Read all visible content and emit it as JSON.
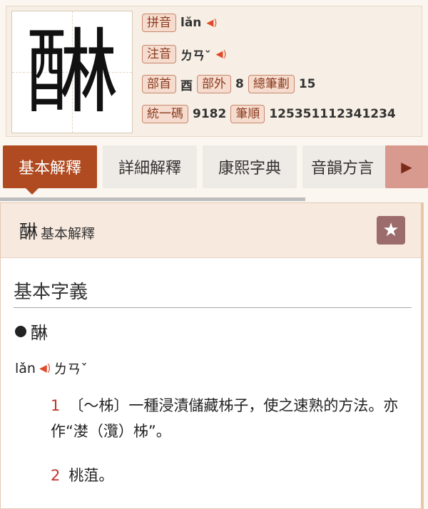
{
  "header": {
    "character": "醂",
    "pinyin_label": "拼音",
    "pinyin": "lǎn",
    "zhuyin_label": "注音",
    "zhuyin": "ㄌㄢˇ",
    "radical_label": "部首",
    "radical": "酉",
    "outer_label": "部外",
    "outer_strokes": "8",
    "total_label": "總筆劃",
    "total_strokes": "15",
    "unicode_label": "統一碼",
    "unicode": "9182",
    "order_label": "筆順",
    "stroke_order": "125351112341234"
  },
  "tabs": [
    {
      "label": "基本解釋",
      "active": true
    },
    {
      "label": "詳細解釋",
      "active": false
    },
    {
      "label": "康熙字典",
      "active": false
    },
    {
      "label": "音韻方言",
      "active": false
    }
  ],
  "panel": {
    "char": "醂",
    "title": "基本解釋",
    "section_title": "基本字義",
    "entry_char": "醂",
    "pron_pinyin": "lǎn",
    "pron_zhuyin": "ㄌㄢˇ",
    "definitions": [
      {
        "num": "1",
        "text": "〔～柹〕一種浸漬儲藏柹子，使之速熟的方法。亦作“漤（灠）柹”。"
      },
      {
        "num": "2",
        "text": "桃菹。"
      }
    ]
  },
  "colors": {
    "accent": "#b04a20",
    "tag_bg": "#f6dccf",
    "number": "#c4322a"
  },
  "icons": {
    "speaker": "speaker-icon",
    "star": "star-icon",
    "next": "chevron-right-icon"
  }
}
